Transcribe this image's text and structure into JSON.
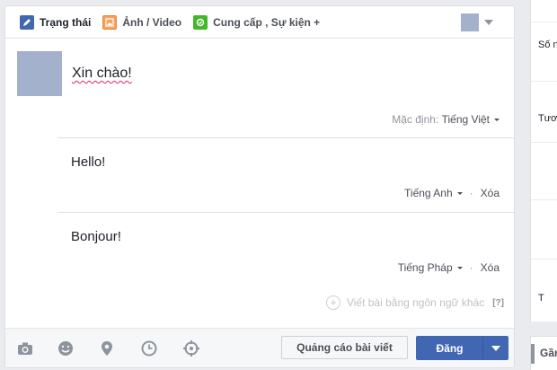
{
  "tabs": [
    {
      "label": "Trạng thái",
      "icon": "pencil-icon"
    },
    {
      "label": "Ảnh / Video",
      "icon": "photo-icon"
    },
    {
      "label": "Cung cấp , Sự kiện +",
      "icon": "offer-icon"
    }
  ],
  "post": {
    "text": "Xin chào!",
    "default_label": "Mặc định:",
    "default_language": "Tiếng Việt"
  },
  "translations": [
    {
      "text": "Hello!",
      "language": "Tiếng Anh",
      "delete": "Xóa"
    },
    {
      "text": "Bonjour!",
      "language": "Tiếng Pháp",
      "delete": "Xóa"
    }
  ],
  "add_language": {
    "label": "Viết bài bằng ngôn ngữ khác",
    "help": "[?]"
  },
  "footer": {
    "icons": [
      "camera-icon",
      "emoji-icon",
      "location-icon",
      "clock-icon",
      "target-icon"
    ],
    "boost_label": "Quảng cáo bài viết",
    "post_label": "Đăng"
  },
  "right_panel": {
    "items": [
      "Số người",
      "Tương tác",
      "T"
    ],
    "bottom_label": "Gần đây"
  },
  "colors": {
    "accent": "#4267b2",
    "background": "#e9ebee"
  }
}
